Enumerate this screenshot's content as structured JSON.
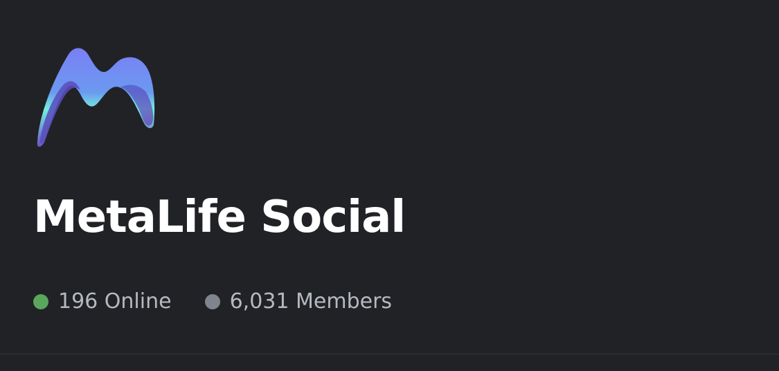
{
  "server": {
    "name": "MetaLife Social",
    "logo_icon": "metalife-logo-icon"
  },
  "stats": {
    "online_label": "196 Online",
    "online_color": "#5aa65d",
    "members_label": "6,031 Members",
    "members_color": "#7f848e"
  },
  "theme": {
    "background": "#212226",
    "text_primary": "#ffffff",
    "text_secondary": "#b5b9c0"
  }
}
